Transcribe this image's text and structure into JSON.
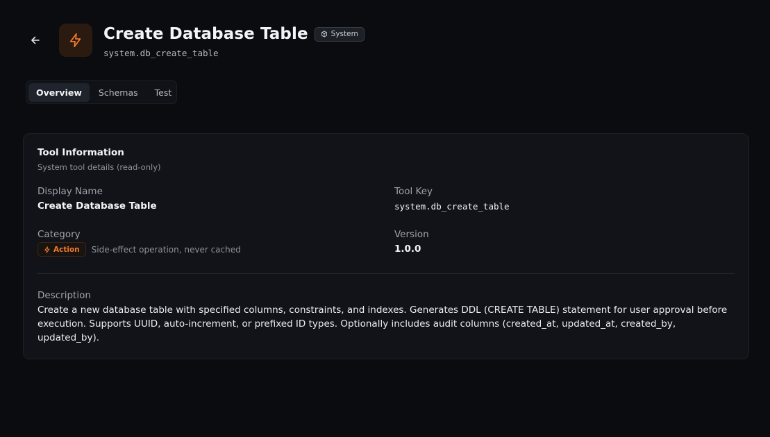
{
  "header": {
    "title": "Create Database Table",
    "badge": "System",
    "subtitle": "system.db_create_table"
  },
  "tabs": [
    {
      "label": "Overview",
      "active": true
    },
    {
      "label": "Schemas",
      "active": false
    },
    {
      "label": "Test",
      "active": false
    }
  ],
  "card": {
    "title": "Tool Information",
    "subtitle": "System tool details (read-only)",
    "display_name_label": "Display Name",
    "display_name_value": "Create Database Table",
    "tool_key_label": "Tool Key",
    "tool_key_value": "system.db_create_table",
    "category_label": "Category",
    "category_badge": "Action",
    "category_note": "Side-effect operation, never cached",
    "version_label": "Version",
    "version_value": "1.0.0",
    "description_label": "Description",
    "description_value": "Create a new database table with specified columns, constraints, and indexes. Generates DDL (CREATE TABLE) statement for user approval before execution. Supports UUID, auto-increment, or prefixed ID types. Optionally includes audit columns (created_at, updated_at, created_by, updated_by)."
  },
  "colors": {
    "background": "#0b0c10",
    "card": "#111318",
    "accent": "#f07a2a"
  },
  "icons": {
    "back": "arrow-left-icon",
    "tool": "lightning-icon",
    "system": "cube-icon",
    "action": "lightning-icon"
  }
}
